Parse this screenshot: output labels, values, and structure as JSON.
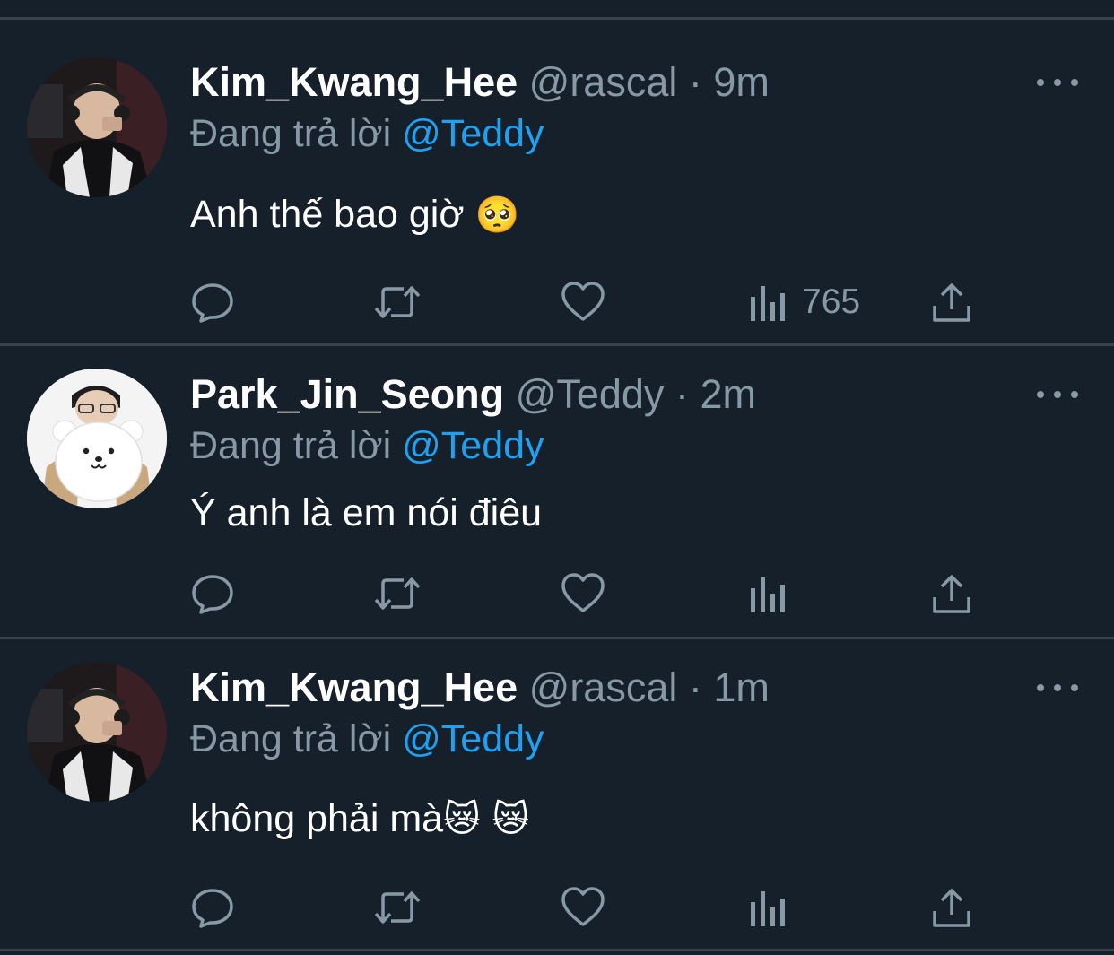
{
  "tweets": [
    {
      "name": "Kim_Kwang_Hee",
      "handle": "@rascal",
      "dot": "·",
      "time": "9m",
      "reply_prefix": "Đang trả lời",
      "reply_to": "@Teddy",
      "text": "Anh thế bao giờ",
      "emoji": "🥺",
      "views": "765",
      "avatar": "player-photo-avatar"
    },
    {
      "name": "Park_Jin_Seong",
      "handle": "@Teddy",
      "dot": "·",
      "time": "2m",
      "reply_prefix": "Đang trả lời",
      "reply_to": "@Teddy",
      "text": "Ý anh là em nói điêu",
      "emoji": "",
      "views": "",
      "avatar": "plush-bear-avatar"
    },
    {
      "name": "Kim_Kwang_Hee",
      "handle": "@rascal",
      "dot": "·",
      "time": "1m",
      "reply_prefix": "Đang trả lời",
      "reply_to": "@Teddy",
      "text": "không phải mà",
      "emoji": "😿 😿",
      "views": "",
      "avatar": "player-photo-avatar"
    }
  ],
  "icons": {
    "reply": "reply-icon",
    "retweet": "retweet-icon",
    "like": "like-icon",
    "views": "views-icon",
    "share": "share-icon",
    "more": "more-icon"
  },
  "colors": {
    "background": "#15202b",
    "separator": "#38444d",
    "secondary_text": "#8899a6",
    "mention": "#1da1f2",
    "primary_text": "#ffffff"
  }
}
